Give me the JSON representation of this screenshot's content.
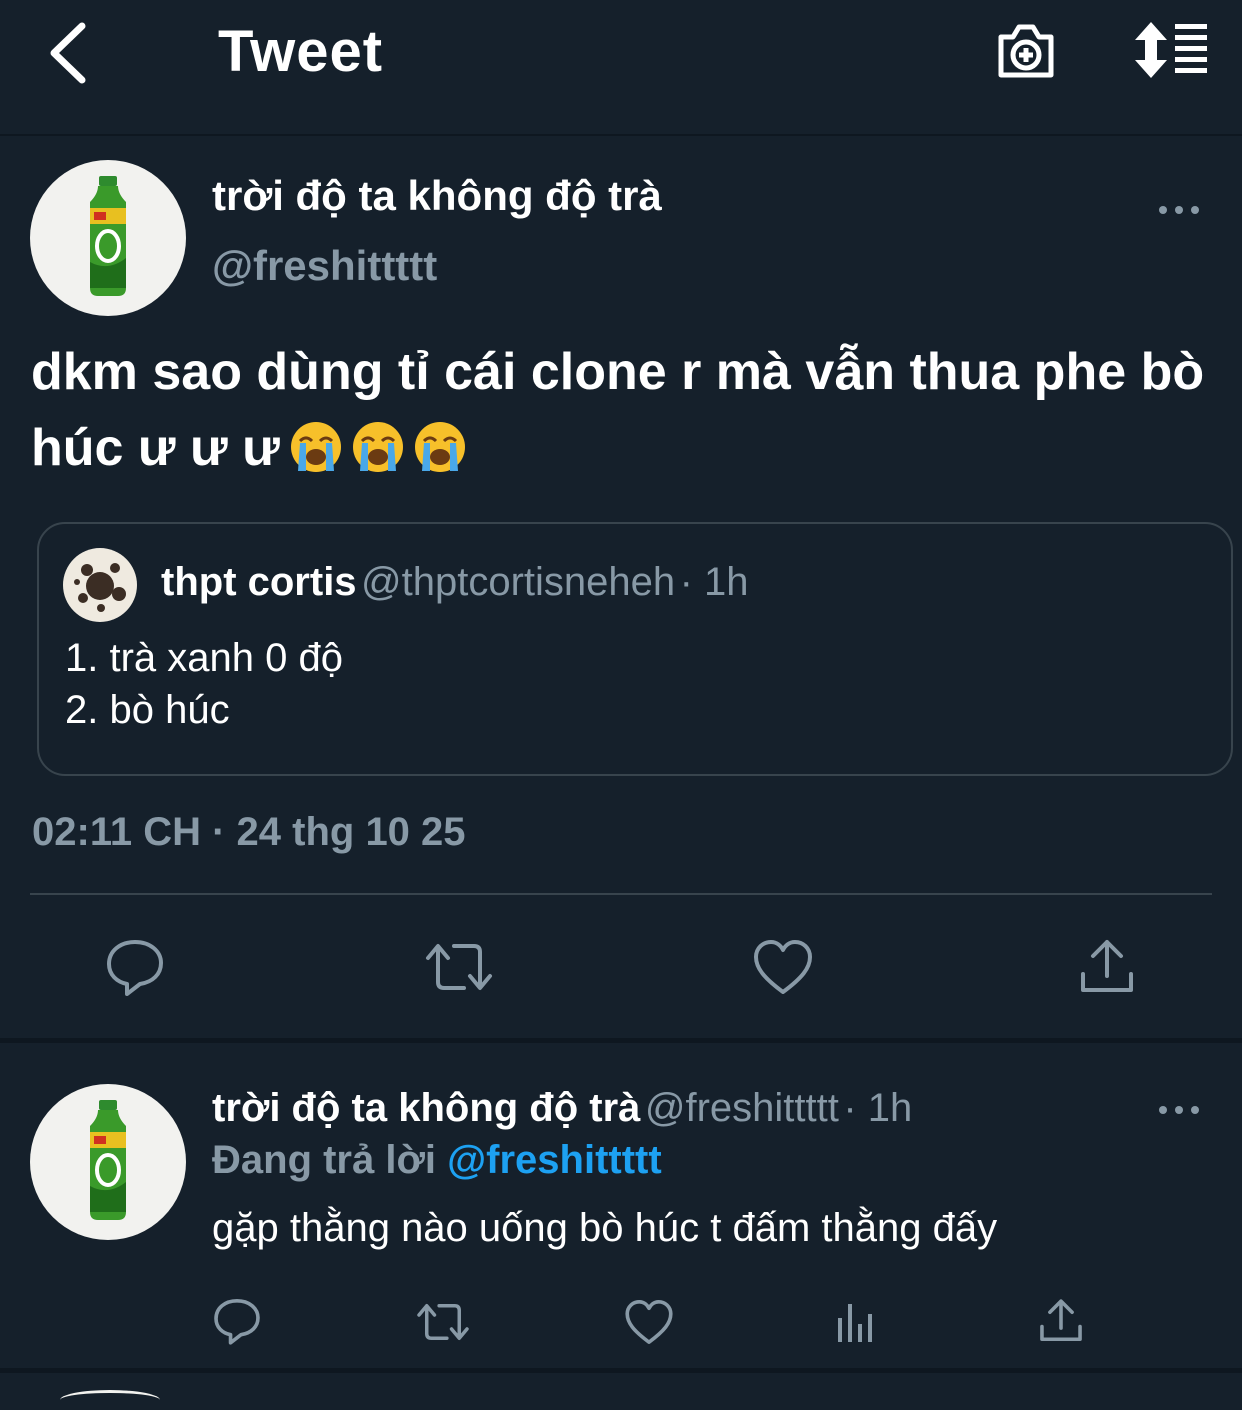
{
  "header": {
    "title": "Tweet",
    "back_icon": "chevron-left-icon",
    "camera_icon": "camera-plus-icon",
    "sort_icon": "sort-list-icon"
  },
  "main_tweet": {
    "author_name": "trời độ ta không độ trà",
    "author_handle": "@freshittttt",
    "text": "dkm sao dùng tỉ cái clone r mà vẫn thua phe bò húc ư ư ư",
    "emoji": [
      "loudly-crying-face",
      "loudly-crying-face",
      "loudly-crying-face"
    ],
    "quote": {
      "author_name": "thpt cortis",
      "author_handle": "@thptcortisneheh",
      "time": "· 1h",
      "lines": [
        "1. trà xanh 0 độ",
        "2. bò húc"
      ]
    },
    "timestamp": "02:11 CH · 24 thg 10 25",
    "actions": [
      "reply-icon",
      "retweet-icon",
      "like-icon",
      "share-icon"
    ]
  },
  "reply_tweet": {
    "author_name": "trời độ ta không độ trà",
    "author_handle": "@freshittttt",
    "time": "· 1h",
    "replying_label": "Đang trả lời",
    "replying_to": "@freshittttt",
    "text": "gặp thằng nào uống bò húc t đấm thằng đấy",
    "actions": [
      "reply-icon",
      "retweet-icon",
      "like-icon",
      "analytics-icon",
      "share-icon"
    ]
  },
  "colors": {
    "background": "#15202b",
    "secondary_text": "#8899a6",
    "accent": "#1da1f2",
    "border": "#38444d"
  }
}
